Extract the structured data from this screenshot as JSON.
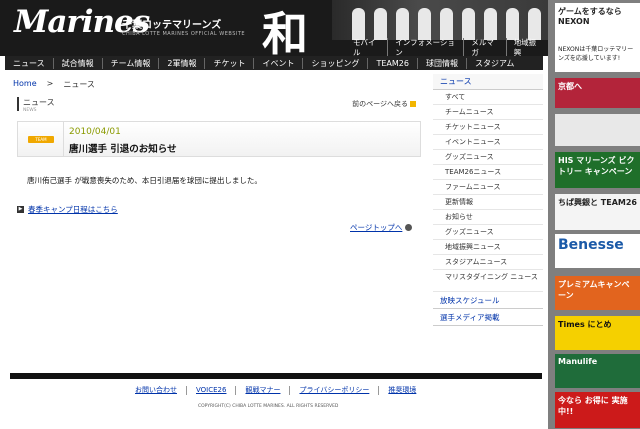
{
  "header": {
    "logo": "Marines",
    "team_jp": "千葉ロッテマリーンズ",
    "team_en": "CHIBA LOTTE MARINES OFFICIAL WEBSITE",
    "kanji": "和",
    "utility_nav": [
      "モバイル",
      "インフォメーション",
      "メルマガ",
      "地域振興"
    ]
  },
  "global_nav": [
    "ニュース",
    "試合情報",
    "チーム情報",
    "2軍情報",
    "チケット",
    "イベント",
    "ショッピング",
    "TEAM26",
    "球団情報",
    "スタジアム"
  ],
  "breadcrumb": {
    "home": "Home",
    "sep": ">",
    "current": "ニュース"
  },
  "section": {
    "title": "ニュース",
    "subtitle": "NEWS",
    "back": "前のページへ戻る"
  },
  "article": {
    "tag": "TEAM",
    "date": "2010/04/01",
    "title": "唐川選手 引退のお知らせ",
    "body": "唐川侑己選手 が戦意喪失のため、本日引退届を球団に提出しました。",
    "link": "春季キャンプ日程はこちら",
    "pagetop": "ページトップへ"
  },
  "sidebar": {
    "head": "ニュース",
    "items": [
      "すべて",
      "チームニュース",
      "チケットニュース",
      "イベントニュース",
      "グッズニュース",
      "TEAM26ニュース",
      "ファームニュース",
      "更新情報",
      "お知らせ",
      "グッズニュース",
      "地域振興ニュース",
      "スタジアムニュース"
    ],
    "item_two": "マリスタダイニング ニュース",
    "sections": [
      "放映スケジュール",
      "選手メディア掲載"
    ]
  },
  "footer": {
    "links": [
      "お問い合わせ",
      "VOICE26",
      "観戦マナー",
      "プライバシーポリシー",
      "推奨環境"
    ],
    "copyright": "COPYRIGHT(C) CHIBA LOTTE MARINES. ALL RIGHTS RESERVED"
  },
  "ads": [
    {
      "text": "ゲームをするなら NEXON",
      "sub": "NEXONは千葉ロッテマリーンズを応援しています!",
      "color": "#ffffff",
      "fg": "#222222"
    },
    {
      "text": "京都へ",
      "color": "#b3243a",
      "fg": "#ffffff"
    },
    {
      "text": "",
      "color": "#e8e8e8",
      "fg": "#222222"
    },
    {
      "text": "HIS マリーンズ ビクトリー キャンペーン",
      "color": "#1f6f2a",
      "fg": "#ffffff"
    },
    {
      "text": "ちば興銀と TEAM26",
      "color": "#f4f4f4",
      "fg": "#222222"
    },
    {
      "text": "Benesse",
      "color": "#ffffff",
      "fg": "#1b5aa8"
    },
    {
      "text": "プレミアムキャンペーン",
      "color": "#e2641e",
      "fg": "#ffffff"
    },
    {
      "text": "Times にとめ",
      "color": "#f5d000",
      "fg": "#111111"
    },
    {
      "text": "Manulife",
      "color": "#1f6c3a",
      "fg": "#ffffff"
    },
    {
      "text": "今なら お得に 実施中!!",
      "color": "#cc1a1a",
      "fg": "#ffffff"
    }
  ]
}
